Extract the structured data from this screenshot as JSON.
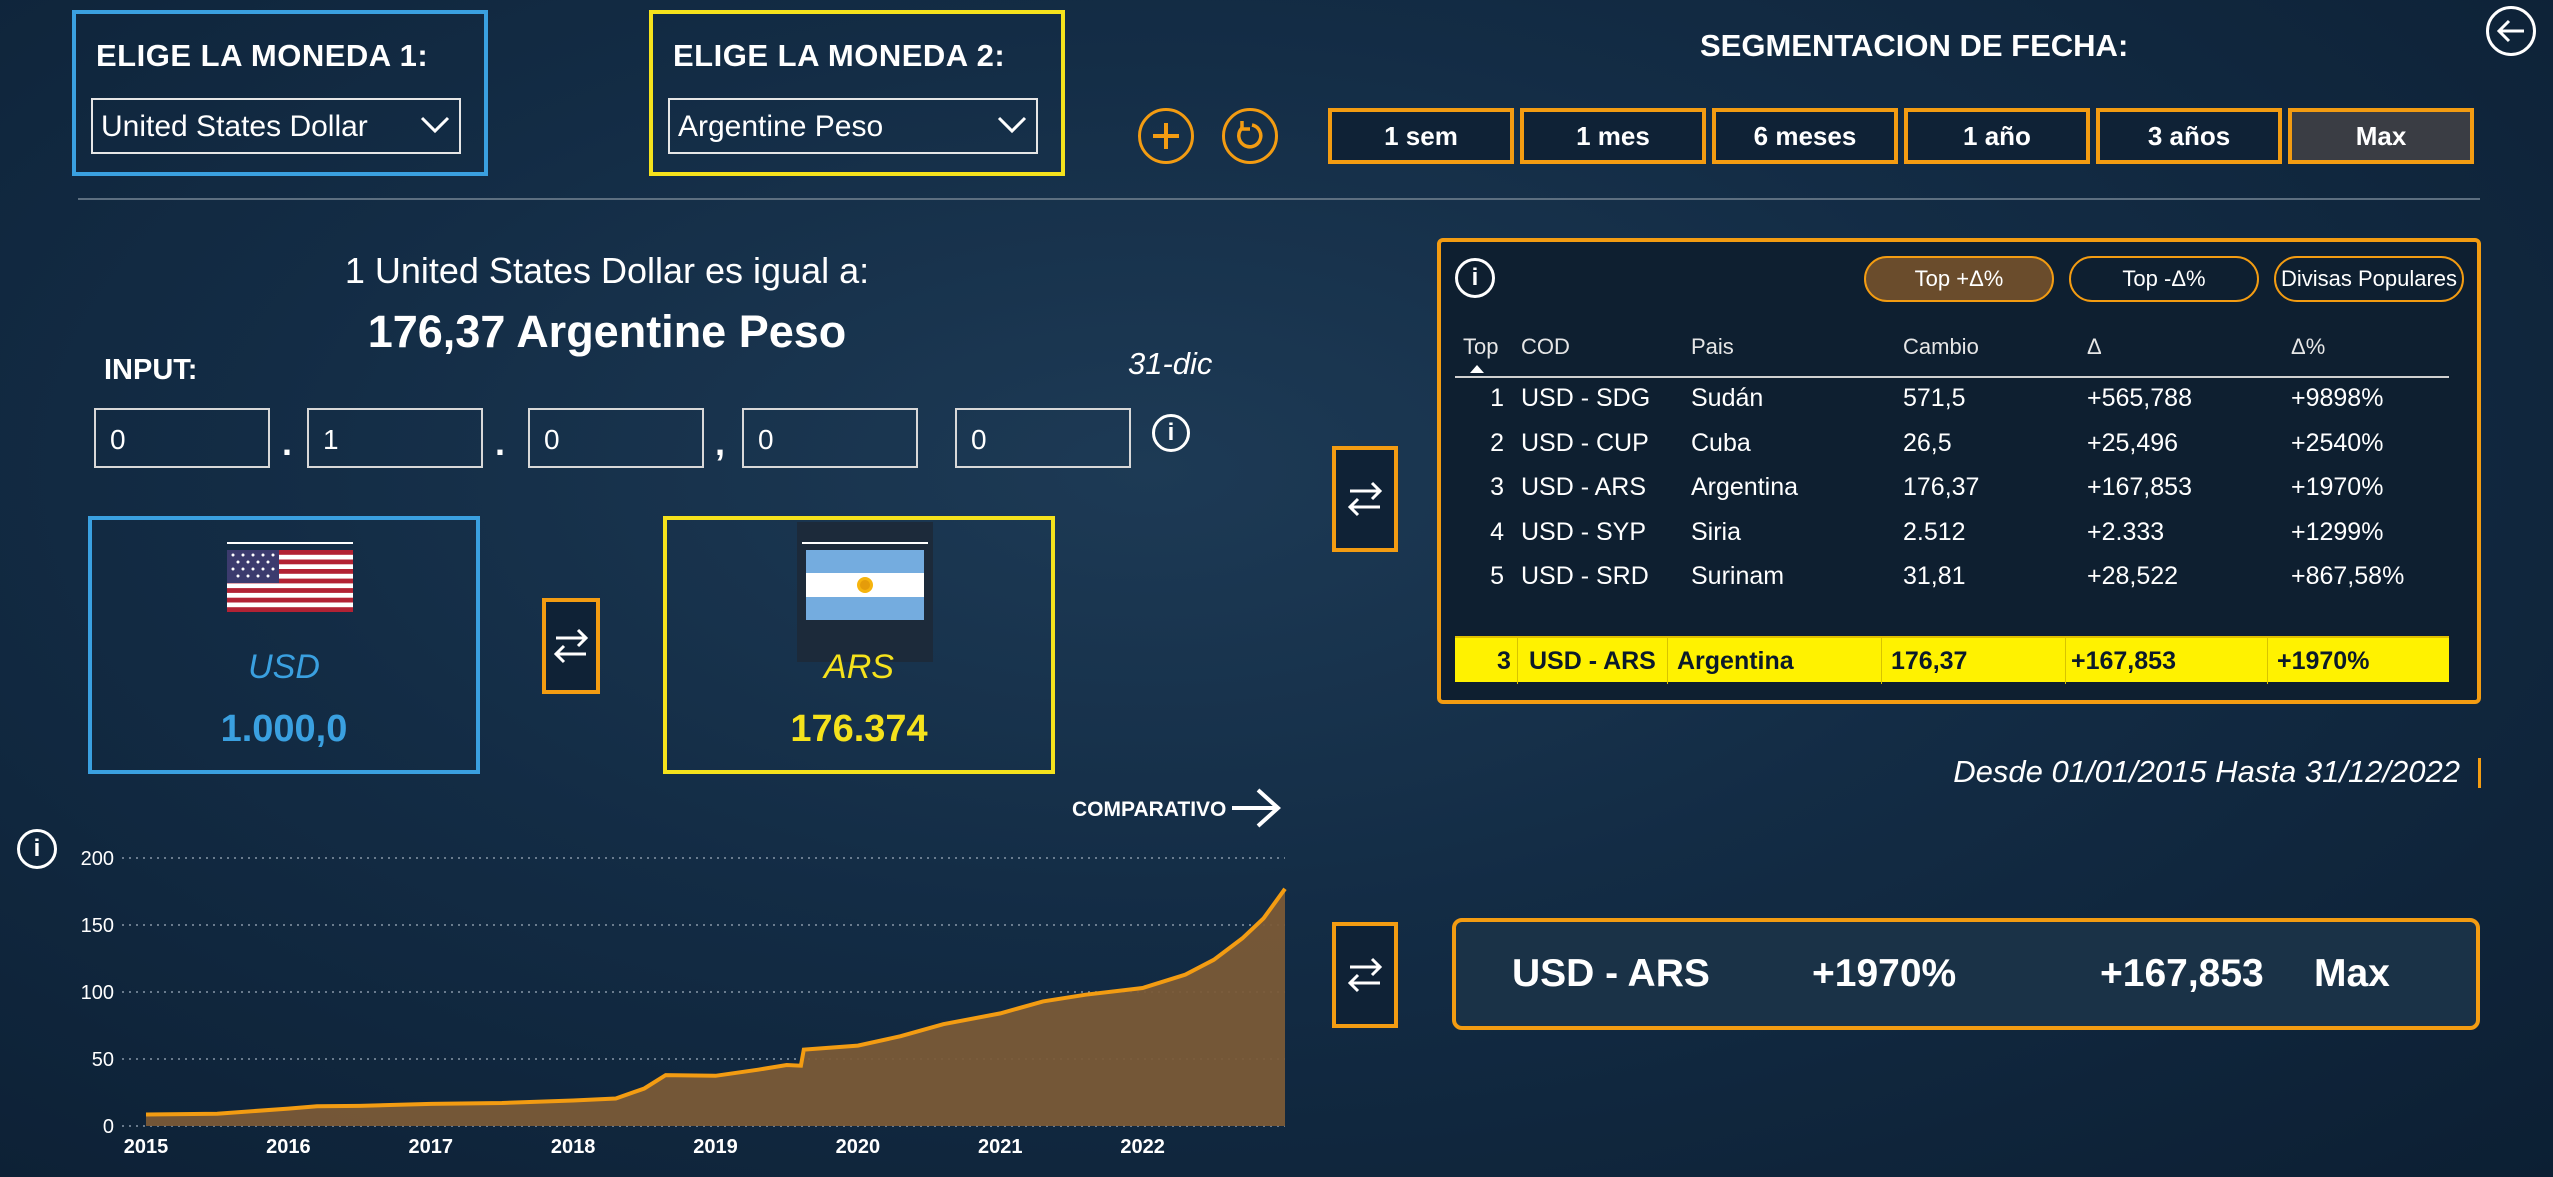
{
  "currency1": {
    "title": "ELIGE LA MONEDA 1:",
    "selected": "United States Dollar",
    "code": "USD",
    "amount": "1.000,0"
  },
  "currency2": {
    "title": "ELIGE LA MONEDA 2:",
    "selected": "Argentine Peso",
    "code": "ARS",
    "amount": "176.374"
  },
  "segment": {
    "title": "SEGMENTACION DE FECHA:",
    "buttons": [
      "1 sem",
      "1 mes",
      "6 meses",
      "1 año",
      "3 años",
      "Max"
    ],
    "active": "Max"
  },
  "conversion": {
    "line1": "1 United States Dollar es igual a:",
    "line2": "176,37 Argentine Peso",
    "date": "31-dic"
  },
  "input": {
    "label": "INPUT:",
    "fields": [
      "0",
      "1",
      "0",
      "0",
      "0"
    ],
    "separators": [
      ".",
      ".",
      ","
    ]
  },
  "comparativo_label": "COMPARATIVO",
  "table": {
    "tabs": [
      "Top +Δ%",
      "Top -Δ%",
      "Divisas Populares"
    ],
    "active_tab": "Top +Δ%",
    "headers": [
      "Top",
      "COD",
      "Pais",
      "Cambio",
      "Δ",
      "Δ%"
    ],
    "rows": [
      {
        "top": "1",
        "cod": "USD - SDG",
        "pais": "Sudán",
        "cambio": "571,5",
        "delta": "+565,788",
        "pct": "+9898%"
      },
      {
        "top": "2",
        "cod": "USD - CUP",
        "pais": "Cuba",
        "cambio": "26,5",
        "delta": "+25,496",
        "pct": "+2540%"
      },
      {
        "top": "3",
        "cod": "USD - ARS",
        "pais": "Argentina",
        "cambio": "176,37",
        "delta": "+167,853",
        "pct": "+1970%"
      },
      {
        "top": "4",
        "cod": "USD - SYP",
        "pais": "Siria",
        "cambio": "2.512",
        "delta": "+2.333",
        "pct": "+1299%"
      },
      {
        "top": "5",
        "cod": "USD - SRD",
        "pais": "Surinam",
        "cambio": "31,81",
        "delta": "+28,522",
        "pct": "+867,58%"
      }
    ],
    "highlight": {
      "top": "3",
      "cod": "USD - ARS",
      "pais": "Argentina",
      "cambio": "176,37",
      "delta": "+167,853",
      "pct": "+1970%"
    }
  },
  "date_range": "Desde 01/01/2015 Hasta 31/12/2022",
  "summary": {
    "pair": "USD - ARS",
    "pct": "+1970%",
    "delta": "+167,853",
    "period": "Max"
  },
  "colors": {
    "accent": "#f39c12",
    "currency1": "#3aa0e0",
    "currency2": "#f5e21c",
    "highlight_row": "#fff200"
  },
  "icons": [
    "back-arrow-icon",
    "plus-icon",
    "refresh-icon",
    "swap-icon",
    "info-icon",
    "dropdown-chevron-icon",
    "arrow-right-icon",
    "us-flag",
    "argentina-flag"
  ],
  "chart_data": {
    "type": "area",
    "title": "",
    "xlabel": "",
    "ylabel": "",
    "x_ticks": [
      "2015",
      "2016",
      "2017",
      "2018",
      "2019",
      "2020",
      "2021",
      "2022"
    ],
    "y_ticks": [
      "0",
      "50",
      "100",
      "150",
      "200"
    ],
    "ylim": [
      0,
      200
    ],
    "xlim": [
      2015,
      2023
    ],
    "grid": "horizontal dotted",
    "series": [
      {
        "x": [
          2015.0,
          2015.5,
          2016.0,
          2016.2,
          2016.5,
          2017.0,
          2017.5,
          2018.0,
          2018.3,
          2018.5,
          2018.65,
          2019.0,
          2019.3,
          2019.5,
          2019.6,
          2019.62,
          2020.0,
          2020.3,
          2020.6,
          2021.0,
          2021.3,
          2021.6,
          2022.0,
          2022.3,
          2022.5,
          2022.7,
          2022.85,
          2023.0
        ],
        "y": [
          8.6,
          9.2,
          13.0,
          14.8,
          15.0,
          16.5,
          17.2,
          19.0,
          20.5,
          28.0,
          38.0,
          37.5,
          42.0,
          45.5,
          45.0,
          57.0,
          60.0,
          67.0,
          76.0,
          84.0,
          93.0,
          98.0,
          103.0,
          113.0,
          124.0,
          140.0,
          155.0,
          177.0
        ]
      }
    ]
  }
}
